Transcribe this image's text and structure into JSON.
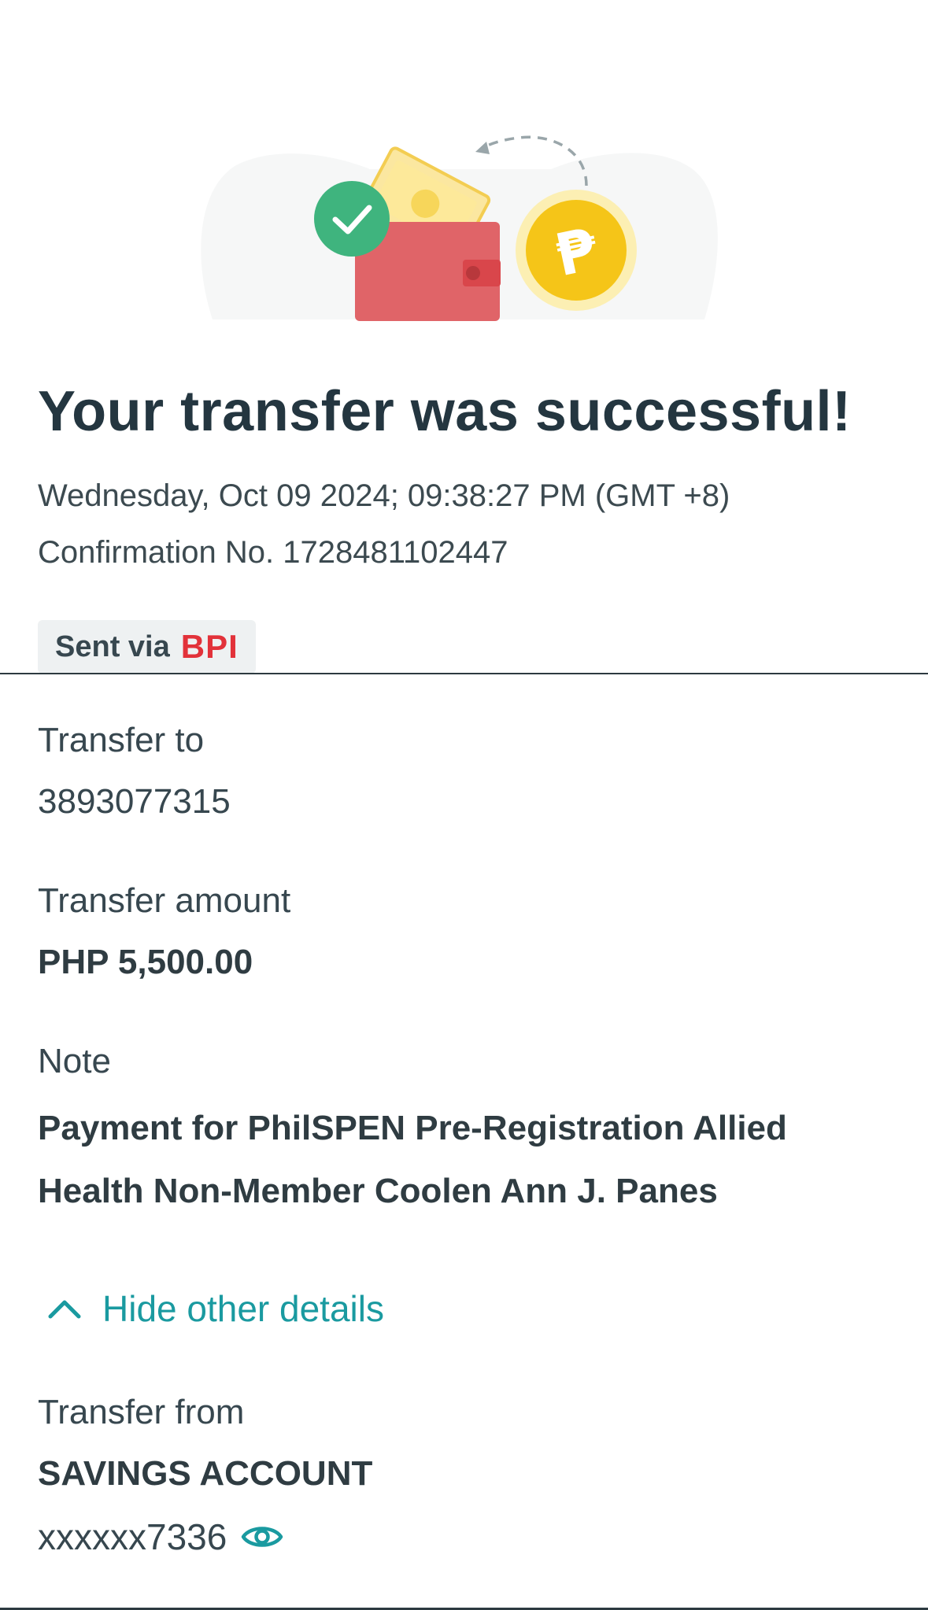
{
  "header": {
    "title": "Your transfer was successful!",
    "datetime": "Wednesday, Oct 09 2024; 09:38:27 PM (GMT +8)",
    "confirmation": "Confirmation No. 1728481102447",
    "sent_via_label": "Sent via",
    "sent_via_bank": "BPI"
  },
  "illustration": {
    "icons": [
      "check-icon",
      "wallet-icon",
      "peso-coin-icon",
      "banknote-icon",
      "return-arrow-icon"
    ],
    "coin_symbol": "₱"
  },
  "details": {
    "transfer_to_label": "Transfer to",
    "transfer_to_value": "3893077315",
    "amount_label": "Transfer amount",
    "amount_value": "PHP 5,500.00",
    "note_label": "Note",
    "note_value": "Payment for PhilSPEN Pre-Registration Allied Health Non-Member Coolen Ann J. Panes",
    "toggle_label": "Hide other details",
    "from_label": "Transfer from",
    "from_account_type": "SAVINGS ACCOUNT",
    "from_account_number": "xxxxxx7336"
  },
  "colors": {
    "text_dark": "#243640",
    "text": "#37474f",
    "accent_teal": "#1a9aa0",
    "bank_red": "#e2323a",
    "check_green": "#3fb47e",
    "wallet_red": "#e06468",
    "coin_yellow": "#f5c518",
    "badge_bg": "#eef1f2"
  }
}
